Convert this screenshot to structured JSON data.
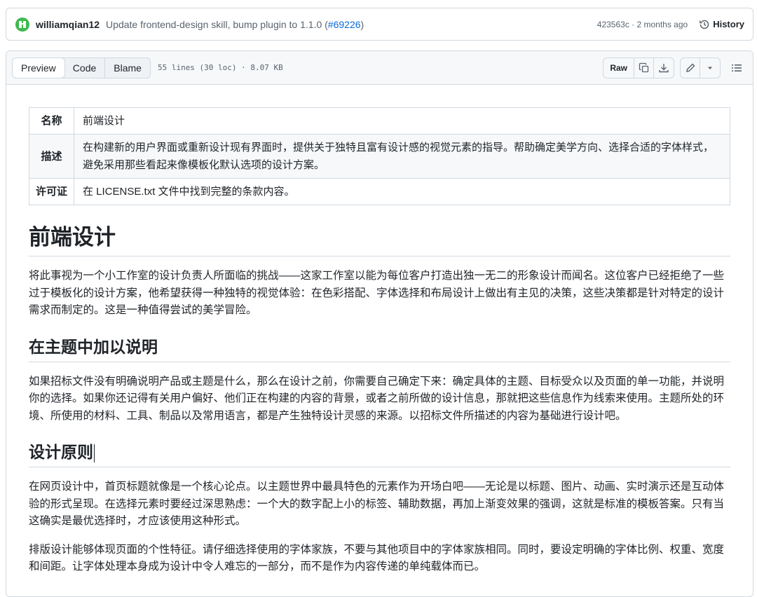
{
  "commit": {
    "author": "williamqian12",
    "message": "Update frontend-design skill, bump plugin to 1.1.0 (",
    "pr_link": "#69226",
    "message_end": ")",
    "meta": "423563c · 2 months ago",
    "history_label": "History"
  },
  "file_header": {
    "tabs": [
      "Preview",
      "Code",
      "Blame"
    ],
    "active_tab": "Preview",
    "info": "55 lines (30 loc) · 8.07 KB",
    "raw_label": "Raw",
    "icons": [
      "copy-icon",
      "download-icon",
      "pencil-icon",
      "chevron-down-icon",
      "list-icon"
    ]
  },
  "meta_table": [
    {
      "key": "名称",
      "value": "前端设计"
    },
    {
      "key": "描述",
      "value": "在构建新的用户界面或重新设计现有界面时，提供关于独特且富有设计感的视觉元素的指导。帮助确定美学方向、选择合适的字体样式，避免采用那些看起来像模板化默认选项的设计方案。"
    },
    {
      "key": "许可证",
      "value": "在 LICENSE.txt 文件中找到完整的条款内容。"
    }
  ],
  "doc": {
    "title": "前端设计",
    "intro": "将此事视为一个小工作室的设计负责人所面临的挑战——这家工作室以能为每位客户打造出独一无二的形象设计而闻名。这位客户已经拒绝了一些过于模板化的设计方案，他希望获得一种独特的视觉体验：在色彩搭配、字体选择和布局设计上做出有主见的决策，这些决策都是针对特定的设计需求而制定的。这是一种值得尝试的美学冒险。",
    "section1_title": "在主题中加以说明",
    "section1_text": "如果招标文件没有明确说明产品或主题是什么，那么在设计之前，你需要自己确定下来：确定具体的主题、目标受众以及页面的单一功能，并说明你的选择。如果你还记得有关用户偏好、他们正在构建的内容的背景，或者之前所做的设计信息，那就把这些信息作为线索来使用。主题所处的环境、所使用的材料、工具、制品以及常用语言，都是产生独特设计灵感的来源。以招标文件所描述的内容为基础进行设计吧。",
    "section2_title": "设计原则",
    "section2_text1": "在网页设计中，首页标题就像是一个核心论点。以主题世界中最具特色的元素作为开场白吧——无论是以标题、图片、动画、实时演示还是互动体验的形式呈现。在选择元素时要经过深思熟虑：一个大的数字配上小的标签、辅助数据，再加上渐变效果的强调，这就是标准的模板答案。只有当这确实是最优选择时，才应该使用这种形式。",
    "section2_text2": "排版设计能够体现页面的个性特征。请仔细选择使用的字体家族，不要与其他项目中的字体家族相同。同时，要设定明确的字体比例、权重、宽度和间距。让字体处理本身成为设计中令人难忘的一部分，而不是作为内容传递的单纯载体而已。"
  }
}
